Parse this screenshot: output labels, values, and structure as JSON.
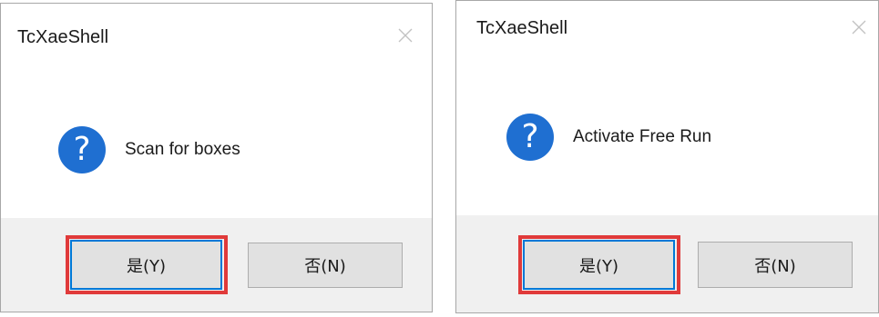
{
  "dialogs": [
    {
      "title": "TcXaeShell",
      "icon": "question-icon",
      "message": "Scan for boxes",
      "yes_label": "是(Y)",
      "no_label": "否(N)",
      "highlighted_button": "yes"
    },
    {
      "title": "TcXaeShell",
      "icon": "question-icon",
      "message": "Activate Free Run",
      "yes_label": "是(Y)",
      "no_label": "否(N)",
      "highlighted_button": "yes"
    }
  ],
  "question_glyph": "?",
  "colors": {
    "icon_blue": "#1f6fd1",
    "highlight_red": "#e03a3a",
    "focus_blue": "#0078d7",
    "footer_gray": "#f0f0f0",
    "button_gray": "#e1e1e1"
  }
}
